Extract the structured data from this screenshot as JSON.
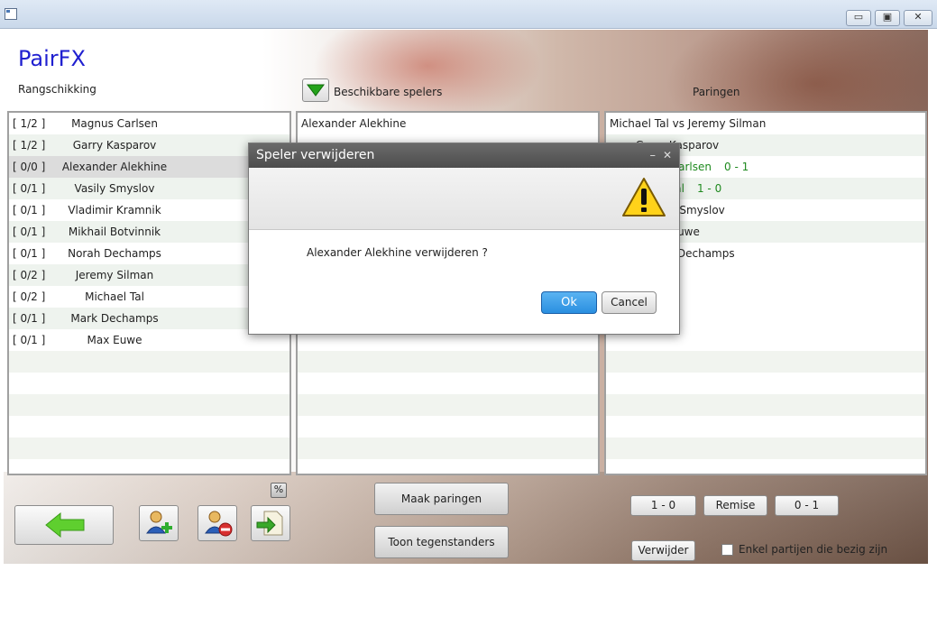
{
  "window": {
    "minimize_glyph": "▭",
    "restore_glyph": "▣",
    "close_glyph": "✕"
  },
  "app": {
    "title": "PairFX"
  },
  "headers": {
    "ranking": "Rangschikking",
    "available": "Beschikbare spelers",
    "pairings": "Paringen"
  },
  "ranking": [
    {
      "score": "[ 1/2  ]",
      "name": "Magnus Carlsen"
    },
    {
      "score": "[ 1/2  ]",
      "name": "Garry Kasparov"
    },
    {
      "score": "[ 0/0  ]",
      "name": "Alexander Alekhine"
    },
    {
      "score": "[ 0/1  ]",
      "name": "Vasily Smyslov"
    },
    {
      "score": "[ 0/1  ]",
      "name": "Vladimir Kramnik"
    },
    {
      "score": "[ 0/1  ]",
      "name": "Mikhail Botvinnik"
    },
    {
      "score": "[ 0/1  ]",
      "name": "Norah Dechamps"
    },
    {
      "score": "[ 0/2  ]",
      "name": "Jeremy Silman"
    },
    {
      "score": "[ 0/2  ]",
      "name": "Michael Tal"
    },
    {
      "score": "[ 0/1  ]",
      "name": "Mark Dechamps"
    },
    {
      "score": "[ 0/1  ]",
      "name": "Max Euwe"
    }
  ],
  "available": [
    "Alexander Alekhine"
  ],
  "pairings": [
    {
      "text": "Michael Tal vs Jeremy Silman",
      "result": ""
    },
    {
      "text": "n vs Garry Kasparov",
      "result": ""
    },
    {
      "text": "vs Magnus Carlsen",
      "result": "0 - 1"
    },
    {
      "text": "vs Michael Tal",
      "result": "1 - 0"
    },
    {
      "text": "nik vs Vasily Smyslov",
      "result": ""
    },
    {
      "text": "nik vs Max Euwe",
      "result": ""
    },
    {
      "text": "ps vs Norah Dechamps",
      "result": ""
    }
  ],
  "buttons": {
    "make_pairings": "Maak paringen",
    "show_opponents": "Toon tegenstanders",
    "white_wins": "1 - 0",
    "draw": "Remise",
    "black_wins": "0 - 1",
    "remove": "Verwijder",
    "percent": "%"
  },
  "filter": {
    "label": "Enkel partijen die bezig zijn",
    "checked": false
  },
  "dialog": {
    "title": "Speler verwijderen",
    "message": "Alexander Alekhine  verwijderen ?",
    "ok": "Ok",
    "cancel": "Cancel",
    "minimize_glyph": "–",
    "close_glyph": "✕"
  },
  "colors": {
    "title_blue": "#2020d0",
    "result_green": "#1f8a1f",
    "ok_blue": "#2a8fe0",
    "arrow_green": "#5fcf2f"
  }
}
